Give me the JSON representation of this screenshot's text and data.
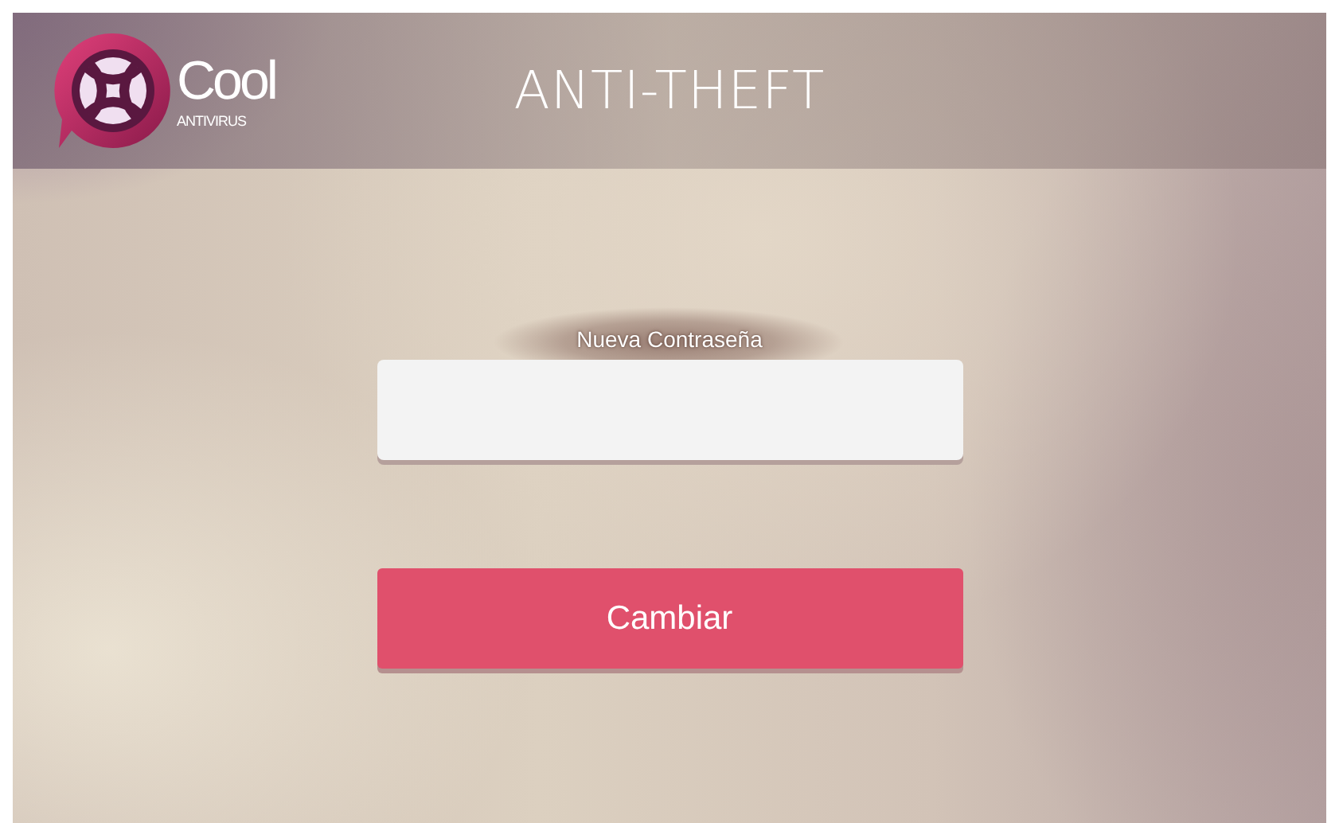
{
  "header": {
    "logo": {
      "name": "Cool",
      "tagline": "ANTIVIRUS"
    },
    "title": "ANTI-THEFT"
  },
  "form": {
    "field_label": "Nueva Contraseña",
    "submit": "Cambiar"
  }
}
